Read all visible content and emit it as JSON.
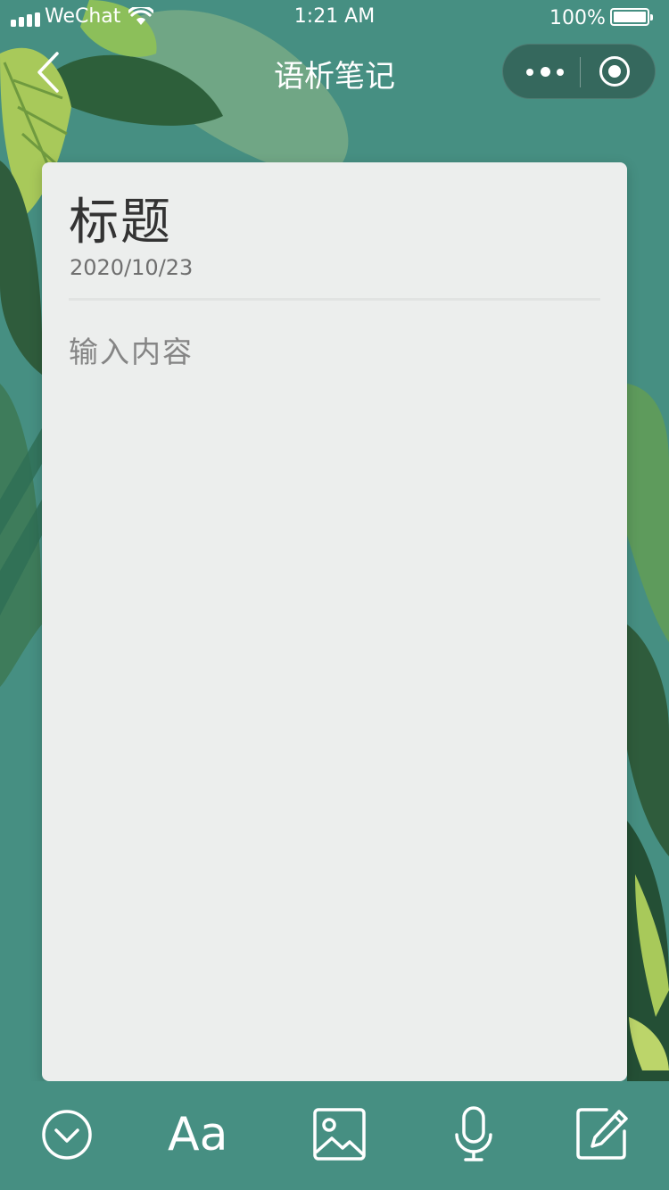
{
  "status_bar": {
    "carrier": "WeChat",
    "time": "1:21 AM",
    "battery_percent": "100%",
    "icons": [
      "signal-icon",
      "wifi-icon",
      "battery-icon"
    ]
  },
  "nav": {
    "title": "语析笔记",
    "icons": [
      "back-chevron-icon",
      "more-dots-icon",
      "close-target-icon"
    ]
  },
  "note": {
    "title": "标题",
    "date": "2020/10/23",
    "body_placeholder": "输入内容"
  },
  "toolbar": {
    "font_label": "Aa",
    "icons": [
      "collapse-chevron-icon",
      "font-icon",
      "image-icon",
      "microphone-icon",
      "edit-icon"
    ]
  },
  "colors": {
    "background": "#468f82",
    "card": "#eceeed",
    "title_text": "#333333",
    "muted_text": "#858585",
    "leaf_dark": "#2f6a47",
    "leaf_mid": "#5e9b5c",
    "leaf_light": "#a8c95a"
  }
}
